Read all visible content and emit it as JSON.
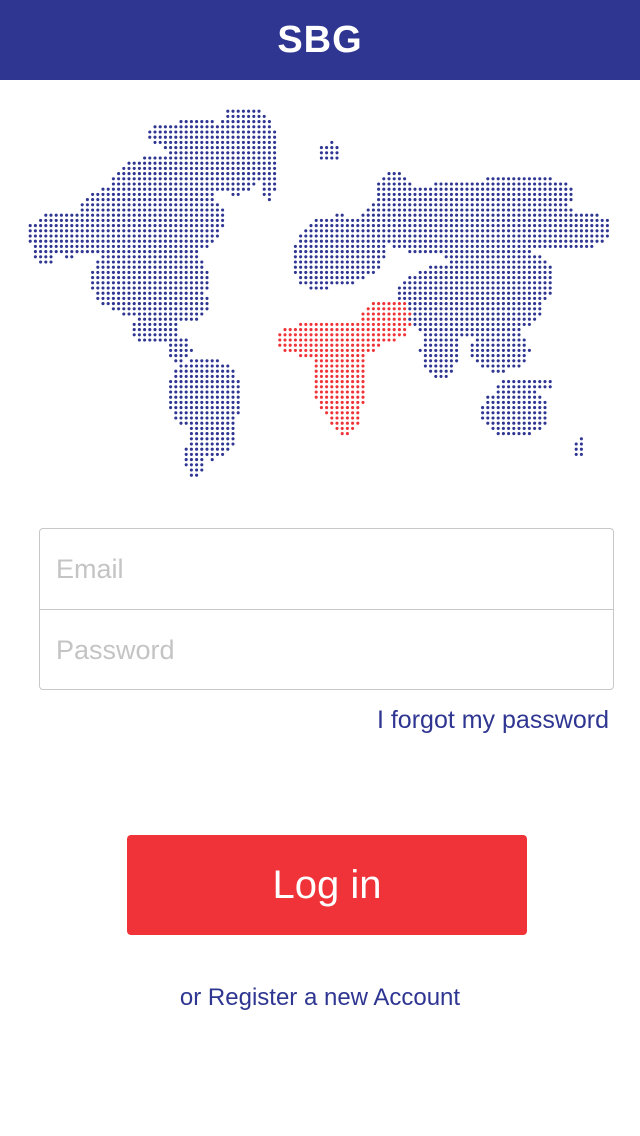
{
  "header": {
    "title": "SBG",
    "background": "#2e3692"
  },
  "map": {
    "dot_color": "#2e3692",
    "highlight_color": "#ef3338",
    "highlight_region": "Africa and Middle East"
  },
  "form": {
    "email": {
      "placeholder": "Email",
      "value": ""
    },
    "password": {
      "placeholder": "Password",
      "value": ""
    }
  },
  "links": {
    "forgot_password": "I forgot my password",
    "register": "or Register a new Account"
  },
  "login_button": {
    "label": "Log in",
    "color": "#ef3338"
  }
}
